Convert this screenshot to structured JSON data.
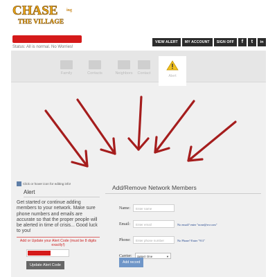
{
  "brand": {
    "logo_line1": "CHASE",
    "logo_suffix": "ing",
    "logo_line2": "THE VILLAGE"
  },
  "header": {
    "status_text": "Status: All is normal. No Worries!"
  },
  "top_nav": {
    "view_alert": "VIEW ALERT",
    "my_account": "MY ACCOUNT",
    "sign_off": "SIGN OFF"
  },
  "social": {
    "facebook": "f",
    "twitter": "t",
    "linkedin": "in"
  },
  "tabs": [
    {
      "label": "Family",
      "icon": "family-icon"
    },
    {
      "label": "Contacts",
      "icon": "contacts-icon"
    },
    {
      "label": "Neighbors",
      "icon": "neighbors-icon"
    },
    {
      "label": "Contact",
      "icon": "contact-icon"
    },
    {
      "label": "Alert",
      "icon": "warning-icon"
    }
  ],
  "left": {
    "edit_hint": "Click or hover icon for editing info!",
    "heading": "Alert",
    "description": "Get started or continue adding members to your network. Make sure phone numbers and emails are accurate so that the proper people will be alerted in time of crisis... Good luck to you!",
    "update_label": "Add or Update your Alert Code (must be 8 digits exactly!)",
    "update_button": "Update Alert Code"
  },
  "form": {
    "title": "Add/Remove Network Members",
    "name_label": "Name:",
    "name_placeholder": "Enter name",
    "email_label": "Email:",
    "email_placeholder": "Enter email",
    "email_note": "No email? enter \"none@rrv.com\"",
    "phone_label": "Phone:",
    "phone_placeholder": "Enter phone number",
    "phone_note": "No Phone? Enter \"911\"",
    "carrier_label": "Carrier:",
    "carrier_selected": "Select One",
    "add_button": "Add record"
  },
  "colors": {
    "accent_red": "#d51a1a",
    "arrow_red": "#a51d1d",
    "nav_dark": "#2c2c2c",
    "add_button_blue": "#6f96c8"
  }
}
